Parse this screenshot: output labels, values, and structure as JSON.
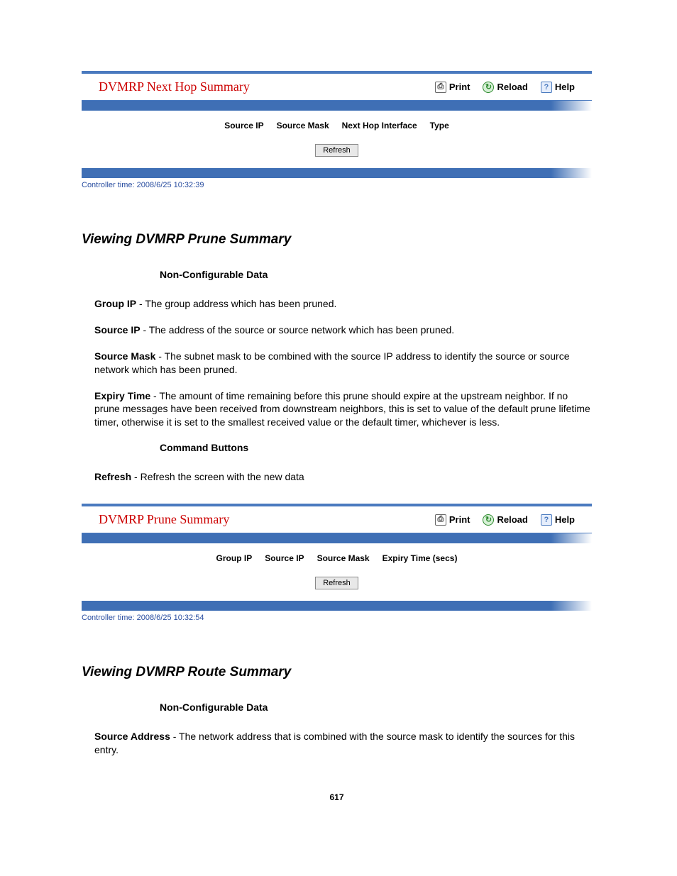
{
  "panel1": {
    "title": "DVMRP Next Hop Summary",
    "actions": {
      "print": "Print",
      "reload": "Reload",
      "help": "Help"
    },
    "columns": [
      "Source IP",
      "Source Mask",
      "Next Hop Interface",
      "Type"
    ],
    "refresh": "Refresh",
    "footer": "Controller time: 2008/6/25 10:32:39"
  },
  "section1": {
    "title": "Viewing DVMRP Prune Summary",
    "nonconf_heading": "Non-Configurable Data",
    "fields": [
      {
        "name": "Group IP",
        "desc": " - The group address which has been pruned."
      },
      {
        "name": "Source IP",
        "desc": " - The address of the source or source network which has been pruned."
      },
      {
        "name": "Source Mask",
        "desc": " - The subnet mask to be combined with the source IP address to identify the source or source network which has been pruned."
      },
      {
        "name": "Expiry Time",
        "desc": " - The amount of time remaining before this prune should expire at the upstream neighbor. If no prune messages have been received from downstream neighbors, this is set to value of the default prune lifetime timer, otherwise it is set to the smallest received value or the default timer, whichever is less."
      }
    ],
    "cmd_heading": "Command Buttons",
    "cmd_field": {
      "name": "Refresh",
      "desc": " - Refresh the screen with the new data"
    }
  },
  "panel2": {
    "title": "DVMRP Prune Summary",
    "actions": {
      "print": "Print",
      "reload": "Reload",
      "help": "Help"
    },
    "columns": [
      "Group IP",
      "Source IP",
      "Source Mask",
      "Expiry Time (secs)"
    ],
    "refresh": "Refresh",
    "footer": "Controller time: 2008/6/25 10:32:54"
  },
  "section2": {
    "title": "Viewing DVMRP Route Summary",
    "nonconf_heading": "Non-Configurable Data",
    "fields": [
      {
        "name": "Source Address",
        "desc": " - The network address that is combined with the source mask to identify the sources for this entry."
      }
    ]
  },
  "page_number": "617"
}
